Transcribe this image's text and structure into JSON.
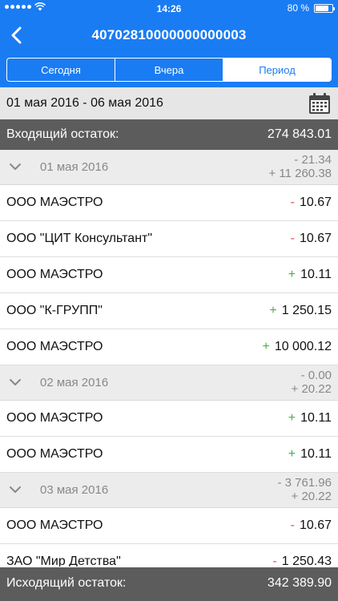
{
  "status_bar": {
    "time": "14:26",
    "battery": "80 %",
    "battery_level": 0.8
  },
  "nav": {
    "title": "40702810000000000003",
    "back_icon": "chevron-left-icon"
  },
  "tabs": [
    {
      "label": "Сегодня",
      "active": false
    },
    {
      "label": "Вчера",
      "active": false
    },
    {
      "label": "Период",
      "active": true
    }
  ],
  "period": {
    "range": "01 мая 2016 - 06 мая 2016",
    "calendar_icon": "calendar-icon"
  },
  "opening_balance": {
    "label": "Входящий остаток:",
    "value": "274 843.01"
  },
  "closing_balance": {
    "label": "Исходящий остаток:",
    "value": "342 389.90"
  },
  "days": [
    {
      "date": "01 мая 2016",
      "debit": "- 21.34",
      "credit": "+ 11 260.38",
      "transactions": [
        {
          "name": "ООО МАЭСТРО",
          "sign": "-",
          "amount": "10.67"
        },
        {
          "name": "ООО \"ЦИТ Консультант\"",
          "sign": "-",
          "amount": "10.67"
        },
        {
          "name": "ООО МАЭСТРО",
          "sign": "+",
          "amount": "10.11"
        },
        {
          "name": "ООО \"К-ГРУПП\"",
          "sign": "+",
          "amount": "1 250.15"
        },
        {
          "name": "ООО МАЭСТРО",
          "sign": "+",
          "amount": "10 000.12"
        }
      ]
    },
    {
      "date": "02 мая 2016",
      "debit": "- 0.00",
      "credit": "+ 20.22",
      "transactions": [
        {
          "name": "ООО МАЭСТРО",
          "sign": "+",
          "amount": "10.11"
        },
        {
          "name": "ООО МАЭСТРО",
          "sign": "+",
          "amount": "10.11"
        }
      ]
    },
    {
      "date": "03 мая 2016",
      "debit": "- 3 761.96",
      "credit": "+ 20.22",
      "transactions": [
        {
          "name": "ООО МАЭСТРО",
          "sign": "-",
          "amount": "10.67"
        },
        {
          "name": "ЗАО \"Мир Детства\"",
          "sign": "-",
          "amount": "1 250.43"
        }
      ]
    }
  ],
  "colors": {
    "accent": "#1a7cf3",
    "minus": "#e8504b",
    "plus": "#4caf50",
    "balance_bg": "#5c5c5c"
  }
}
